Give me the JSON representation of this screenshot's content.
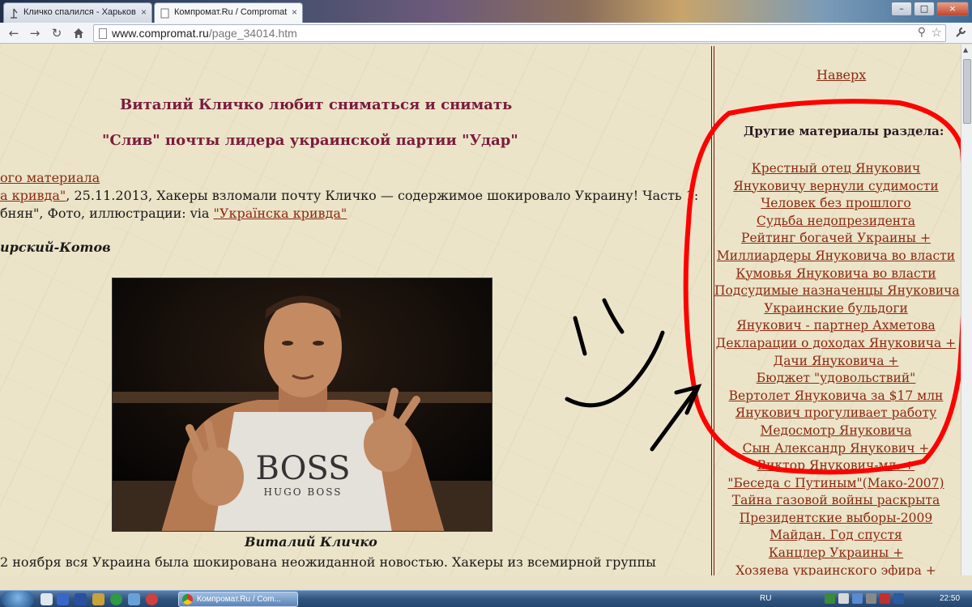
{
  "browser": {
    "tabs": [
      {
        "title": "Кличко спалился - Харьков",
        "active": false
      },
      {
        "title": "Компромат.Ru / Compromat",
        "active": true
      }
    ],
    "url_host": "www.compromat.ru",
    "url_path": "/page_34014.htm"
  },
  "article": {
    "title": "Виталий Кличко любит сниматься и снимать",
    "subtitle": "\"Слив\" почты лидера украинской партии \"Удар\"",
    "source_link": "ого материала",
    "source_line_link": "а кривда\"",
    "source_line_rest": ", 25.11.2013, Хакеры взломали почту Кличко — содержимое шокировало Украину! Часть 1:",
    "via_line_text": "бнян\", Фото, иллюстрации: via ",
    "via_link": "\"Украïнска кривда\"",
    "author": "ирский-Котов",
    "photo_shirt_text": "BOSS",
    "photo_shirt_sub": "HUGO BOSS",
    "photo_caption": "Виталий Кличко",
    "body_start": "2 ноября вся Украина была шокирована неожиданной новостью. Хакеры из всемирной группы"
  },
  "sidebar": {
    "up_link": "Наверх",
    "section_title": "Другие материалы раздела:",
    "links": [
      "Крестный отец Янукович",
      "Януковичу вернули судимости",
      "Человек без прошлого",
      "Судьба недопрезидента",
      "Рейтинг богачей Украины +",
      "Миллиардеры Януковича во власти",
      "Кумовья Януковича во власти",
      "Подсудимые назначенцы Януковича",
      "Украинские бульдоги",
      "Янукович - партнер Ахметова",
      "Декларации о доходах Януковича +",
      "Дачи Януковича +",
      "Бюджет \"удовольствий\"",
      "Вертолет Януковича за $17 млн",
      "Янукович прогуливает работу",
      "Медосмотр Януковича",
      "Сын Александр Янукович +",
      "Виктор Янукович-мл. +",
      "\"Беседа с Путиным\"(Мако-2007)",
      "Тайна газовой войны раскрыта",
      "Президентские выборы-2009",
      "Майдан. Год спустя",
      "Канцлер Украины +",
      "Хозяева украинского эфира +"
    ]
  },
  "taskbar": {
    "task_label": "Компромат.Ru / Com...",
    "language": "RU",
    "clock": "22:50"
  },
  "colors": {
    "heading": "#7a1c3c",
    "link": "#8a2a10",
    "annotation": "#ff0000"
  },
  "icons": [
    "tab-favicon-icon",
    "back-icon",
    "forward-icon",
    "reload-icon",
    "home-icon",
    "page-icon",
    "zoom-icon",
    "star-icon",
    "wrench-icon",
    "start-orb-icon",
    "chrome-icon"
  ]
}
